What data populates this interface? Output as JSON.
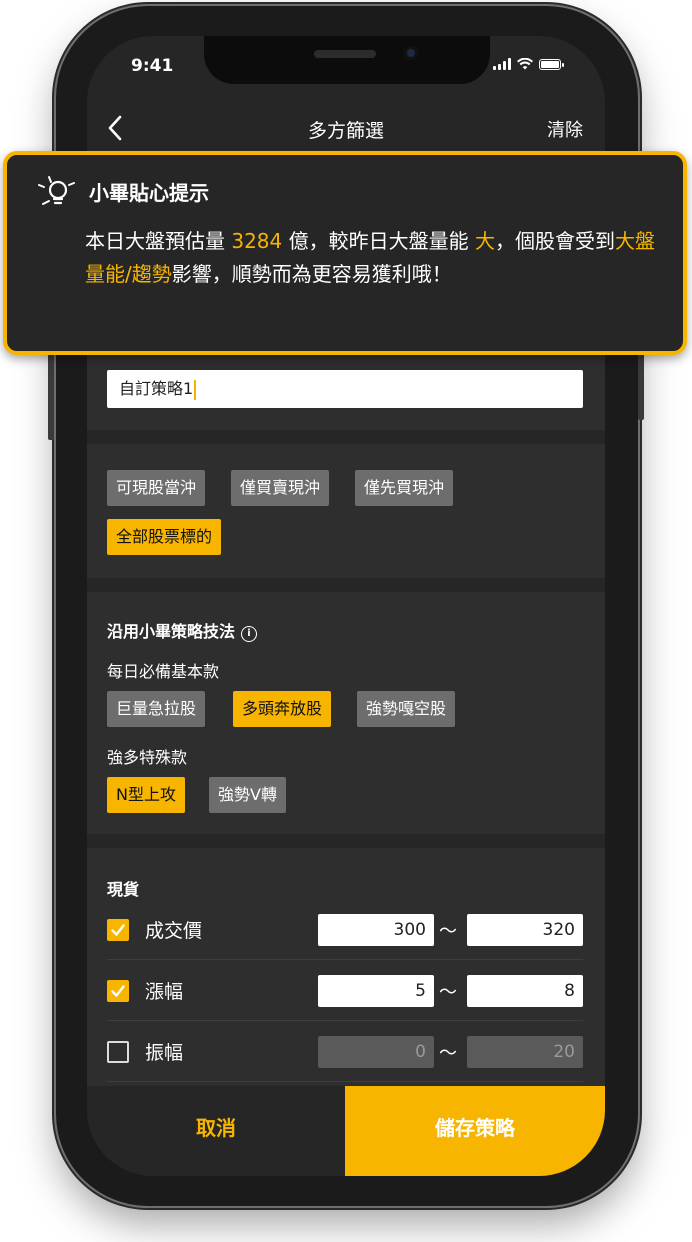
{
  "status_bar": {
    "time": "9:41"
  },
  "nav": {
    "title": "多方篩選",
    "clear_label": "清除"
  },
  "tip": {
    "title": "小畢貼心提示",
    "line1_a": "本日大盤預估量 ",
    "volume": "3284",
    "line1_b": " 億，較昨日大盤量能 ",
    "level": "大",
    "line1_c": "，個股會受到",
    "highlight_phrase": "大盤量能/趨勢",
    "line2_b": "影響，順勢而為更容易獲利哦！"
  },
  "strategy_name": {
    "value": "自訂策略1"
  },
  "trade_types": [
    {
      "label": "可現股當沖",
      "selected": false
    },
    {
      "label": "僅買賣現沖",
      "selected": false
    },
    {
      "label": "僅先買現沖",
      "selected": false
    },
    {
      "label": "全部股票標的",
      "selected": true
    }
  ],
  "strategies": {
    "section_title": "沿用小畢策略技法",
    "info_icon": "info-icon",
    "daily_title": "每日必備基本款",
    "daily": [
      {
        "label": "巨量急拉股",
        "selected": false
      },
      {
        "label": "多頭奔放股",
        "selected": true
      },
      {
        "label": "強勢嘎空股",
        "selected": false
      }
    ],
    "special_title": "強多特殊款",
    "special": [
      {
        "label": "N型上攻",
        "selected": true
      },
      {
        "label": "強勢V轉",
        "selected": false
      }
    ]
  },
  "spot": {
    "section_title": "現貨",
    "tilde": "～",
    "rows": [
      {
        "label": "成交價",
        "checked": true,
        "min": "300",
        "max": "320"
      },
      {
        "label": "漲幅",
        "checked": true,
        "min": "5",
        "max": "8"
      },
      {
        "label": "振幅",
        "checked": false,
        "min": "0",
        "max": "20"
      }
    ]
  },
  "actions": {
    "cancel_label": "取消",
    "save_label": "儲存策略"
  },
  "colors": {
    "accent": "#f7b500",
    "panel": "#2e2e2e",
    "background": "#262626",
    "chip": "#6d6d6d"
  }
}
